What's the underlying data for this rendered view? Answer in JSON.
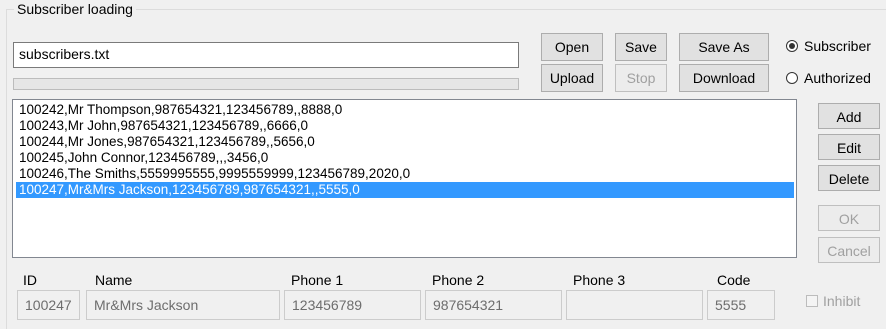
{
  "group": {
    "title": "Subscriber loading"
  },
  "file": {
    "value": "subscribers.txt"
  },
  "progress": {
    "value": 0
  },
  "buttons": {
    "open": "Open",
    "save": "Save",
    "save_as": "Save As",
    "upload": "Upload",
    "stop": "Stop",
    "download": "Download",
    "add": "Add",
    "edit": "Edit",
    "delete": "Delete",
    "ok": "OK",
    "cancel": "Cancel"
  },
  "radios": {
    "subscriber": "Subscriber",
    "authorized": "Authorized",
    "selected": "subscriber"
  },
  "list": {
    "selected_index": 5,
    "items": [
      "100242,Mr Thompson,987654321,123456789,,8888,0",
      "100243,Mr John,987654321,123456789,,6666,0",
      "100244,Mr Jones,987654321,123456789,,5656,0",
      "100245,John Connor,123456789,,,3456,0",
      "100246,The Smiths,5559995555,9995559999,123456789,2020,0",
      "100247,Mr&Mrs Jackson,123456789,987654321,,5555,0"
    ]
  },
  "columns": {
    "id": "ID",
    "name": "Name",
    "phone1": "Phone 1",
    "phone2": "Phone 2",
    "phone3": "Phone 3",
    "code": "Code"
  },
  "record": {
    "id": "100247",
    "name": "Mr&Mrs Jackson",
    "phone1": "123456789",
    "phone2": "987654321",
    "phone3": "",
    "code": "5555"
  },
  "inhibit": {
    "label": "Inhibit",
    "checked": false
  },
  "colors": {
    "selection": "#3399ff",
    "window": "#f0f0f0"
  }
}
